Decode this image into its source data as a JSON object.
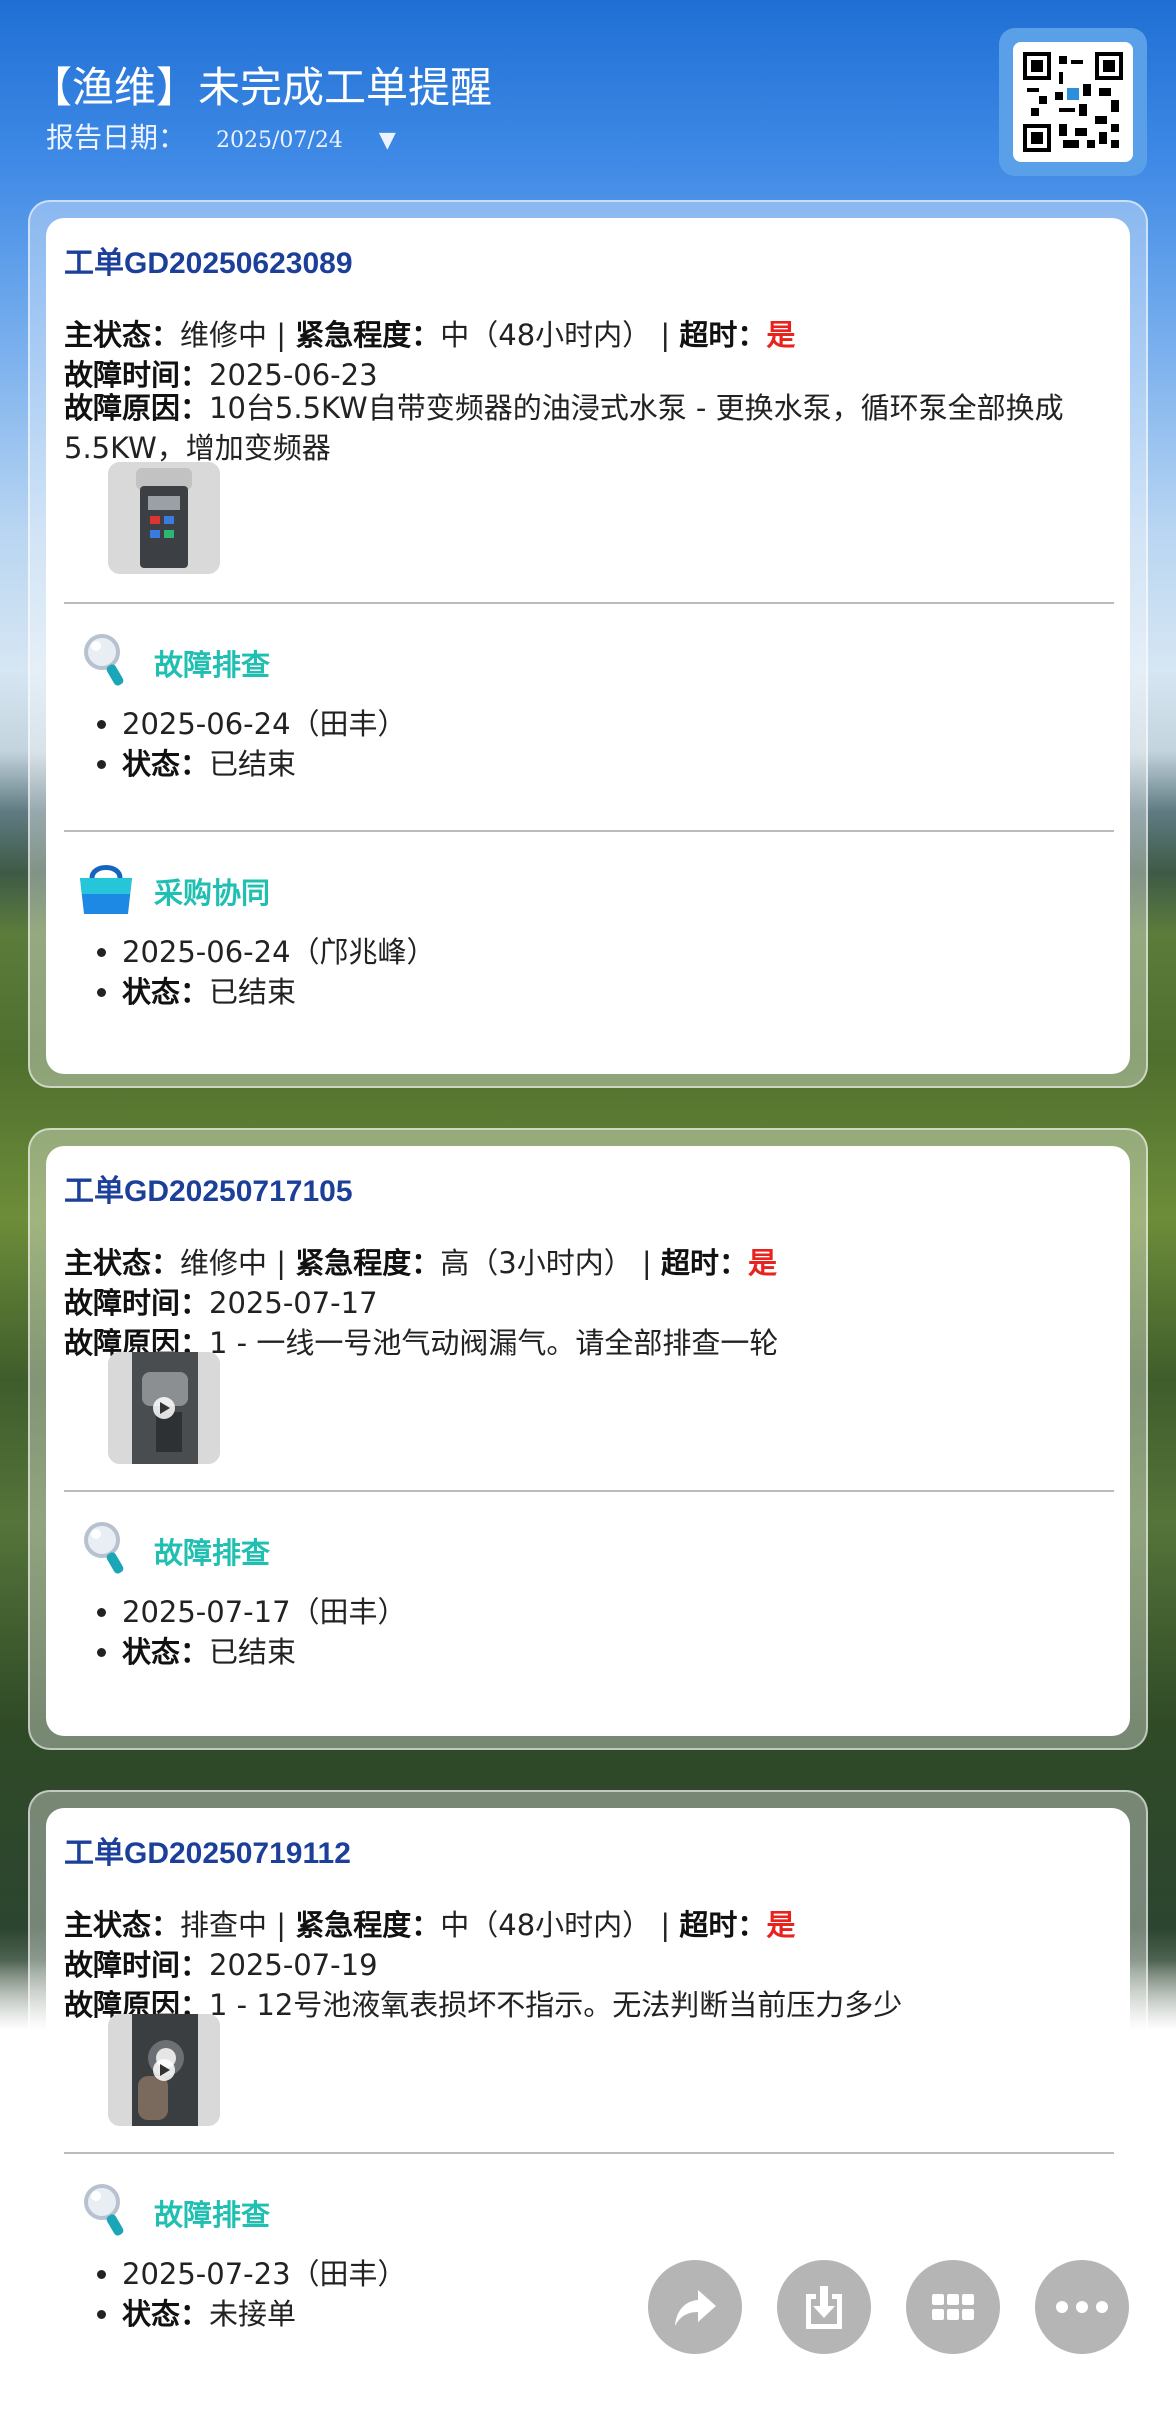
{
  "header": {
    "title": "【渔维】未完成工单提醒",
    "date_label": "报告日期：",
    "date_value": "2025/07/24",
    "date_caret": "▼"
  },
  "labels": {
    "status": "主状态：",
    "urgency": "紧急程度：",
    "overdue": "超时：",
    "fault_time": "故障时间：",
    "fault_reason": "故障原因：",
    "sep1": " | ",
    "sep2": " | ",
    "bullet_status": "状态："
  },
  "orders": [
    {
      "id": "工单GD20250623089",
      "status": "维修中",
      "urgency": "中（48小时内）",
      "overdue": "是",
      "fault_time": "2025-06-23",
      "fault_reason": "10台5.5KW自带变频器的油浸式水泵 - 更换水泵，循环泵全部换成5.5KW，增加变频器",
      "sections": [
        {
          "title": "故障排查",
          "icon": "magnifier-icon",
          "date": "2025-06-24（田丰）",
          "state": "已结束"
        },
        {
          "title": "采购协同",
          "icon": "shopping-bag-icon",
          "date": "2025-06-24（邝兆峰）",
          "state": "已结束"
        }
      ]
    },
    {
      "id": "工单GD20250717105",
      "status": "维修中",
      "urgency": "高（3小时内）",
      "overdue": "是",
      "fault_time": "2025-07-17",
      "fault_reason": "1 - 一线一号池气动阀漏气。请全部排查一轮",
      "sections": [
        {
          "title": "故障排查",
          "icon": "magnifier-icon",
          "date": "2025-07-17（田丰）",
          "state": "已结束"
        }
      ]
    },
    {
      "id": "工单GD20250719112",
      "status": "排查中",
      "urgency": "中（48小时内）",
      "overdue": "是",
      "fault_time": "2025-07-19",
      "fault_reason": "1 - 12号池液氧表损坏不指示。无法判断当前压力多少",
      "sections": [
        {
          "title": "故障排查",
          "icon": "magnifier-icon",
          "date": "2025-07-23（田丰）",
          "state": "未接单"
        }
      ]
    }
  ],
  "fab": [
    "share-icon",
    "download-icon",
    "grid-icon",
    "more-icon"
  ],
  "colors": {
    "title_blue": "#1c3f9a",
    "teal": "#1fbfb1",
    "alert_red": "#e8231d",
    "fab_gray": "#b5b5b5"
  }
}
